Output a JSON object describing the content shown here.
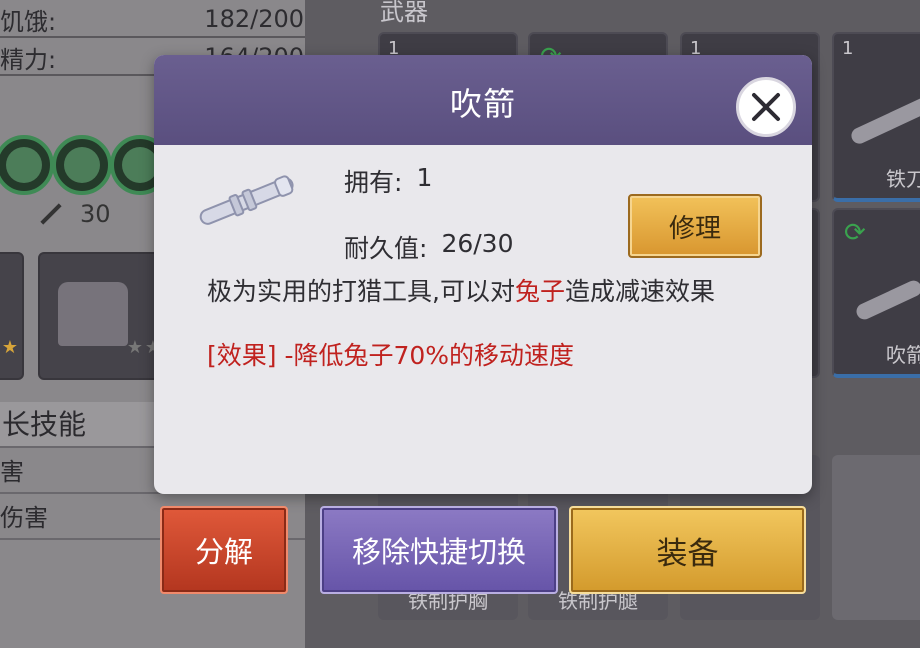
{
  "stats": {
    "hunger_label": "饥饿:",
    "hunger_value": "182/200",
    "energy_label": "精力:",
    "energy_value": "164/200"
  },
  "attack": {
    "value": "30"
  },
  "skills": {
    "header": "长技能",
    "row1": "害",
    "row2": "伤害"
  },
  "weapons_section": {
    "title": "武器"
  },
  "weapon_grid": [
    {
      "qty": "1",
      "label": ""
    },
    {
      "qty": "",
      "label": ""
    },
    {
      "qty": "1",
      "label": ""
    },
    {
      "qty": "1",
      "label": "铁刀"
    },
    {
      "qty": "",
      "label": ""
    },
    {
      "qty": "",
      "label": ""
    },
    {
      "qty": "",
      "label": ""
    },
    {
      "qty": "",
      "label": "吹箭"
    }
  ],
  "equip_cards": [
    {
      "label": "铁制护胸"
    },
    {
      "label": "铁制护腿"
    }
  ],
  "modal": {
    "title": "吹箭",
    "owned_label": "拥有:",
    "owned_value": "1",
    "durability_label": "耐久值:",
    "durability_value": "26/30",
    "repair_label": "修理",
    "desc_part1": "极为实用的打猎工具,可以对",
    "desc_highlight": "兔子",
    "desc_part2": "造成减速效果",
    "effect": "[效果] -降低兔子70%的移动速度"
  },
  "buttons": {
    "decompose": "分解",
    "remove_quick": "移除快捷切换",
    "equip": "装备"
  },
  "colors": {
    "header_purple": "#5a4f7f",
    "highlight_red": "#c0221f",
    "gold": "#d8962f",
    "decompose_red": "#b3361f"
  }
}
